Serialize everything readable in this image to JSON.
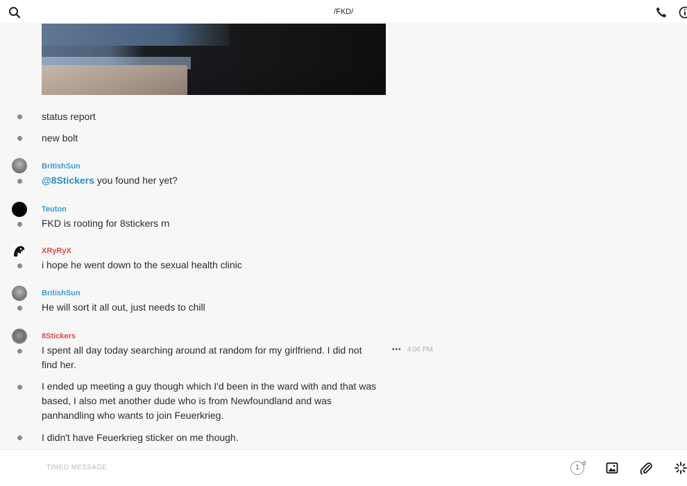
{
  "header": {
    "title": "/FKD/",
    "icons": [
      "search-icon",
      "phone-icon",
      "info-icon"
    ]
  },
  "messages": [
    {
      "text": "status report"
    },
    {
      "text": "new bolt"
    },
    {
      "author": "BritishSun",
      "author_color": "#3a9bd0",
      "mention": "@8Stickers",
      "text": " you found her yet?"
    },
    {
      "author": "Teuton",
      "author_color": "#3a9bd0",
      "text": "FKD is rooting for 8stickers rn"
    },
    {
      "author": "XRyRyX",
      "author_color": "#e2484c",
      "text": "i hope he went down to the sexual health clinic"
    },
    {
      "author": "BritishSun",
      "author_color": "#3a9bd0",
      "text": "He will sort it all out, just needs to chill"
    },
    {
      "author": "8Stickers",
      "author_color": "#e2484c",
      "text_line1": "I spent all day today searching around at random for my girlfriend. I did not",
      "text_line2": "find her.",
      "time": "4:06 PM",
      "more": "•••"
    },
    {
      "text_line1": "I ended up meeting a guy though which I'd been in the ward with and that was",
      "text_line2": "based, I also met another dude who is from Newfoundland and was",
      "text_line3": "panhandling who wants to join Feuerkrieg."
    },
    {
      "text": "I didn't have Feuerkrieg sticker on me though."
    }
  ],
  "composer": {
    "placeholder": "TIMED MESSAGE",
    "timer_value": "1",
    "timer_unit": "d",
    "icons": [
      "image-icon",
      "attach-icon",
      "sparkle-icon"
    ]
  },
  "colors": {
    "accent_blue": "#3a9bd0",
    "accent_red": "#e2484c",
    "mention": "#2a8ec8"
  }
}
